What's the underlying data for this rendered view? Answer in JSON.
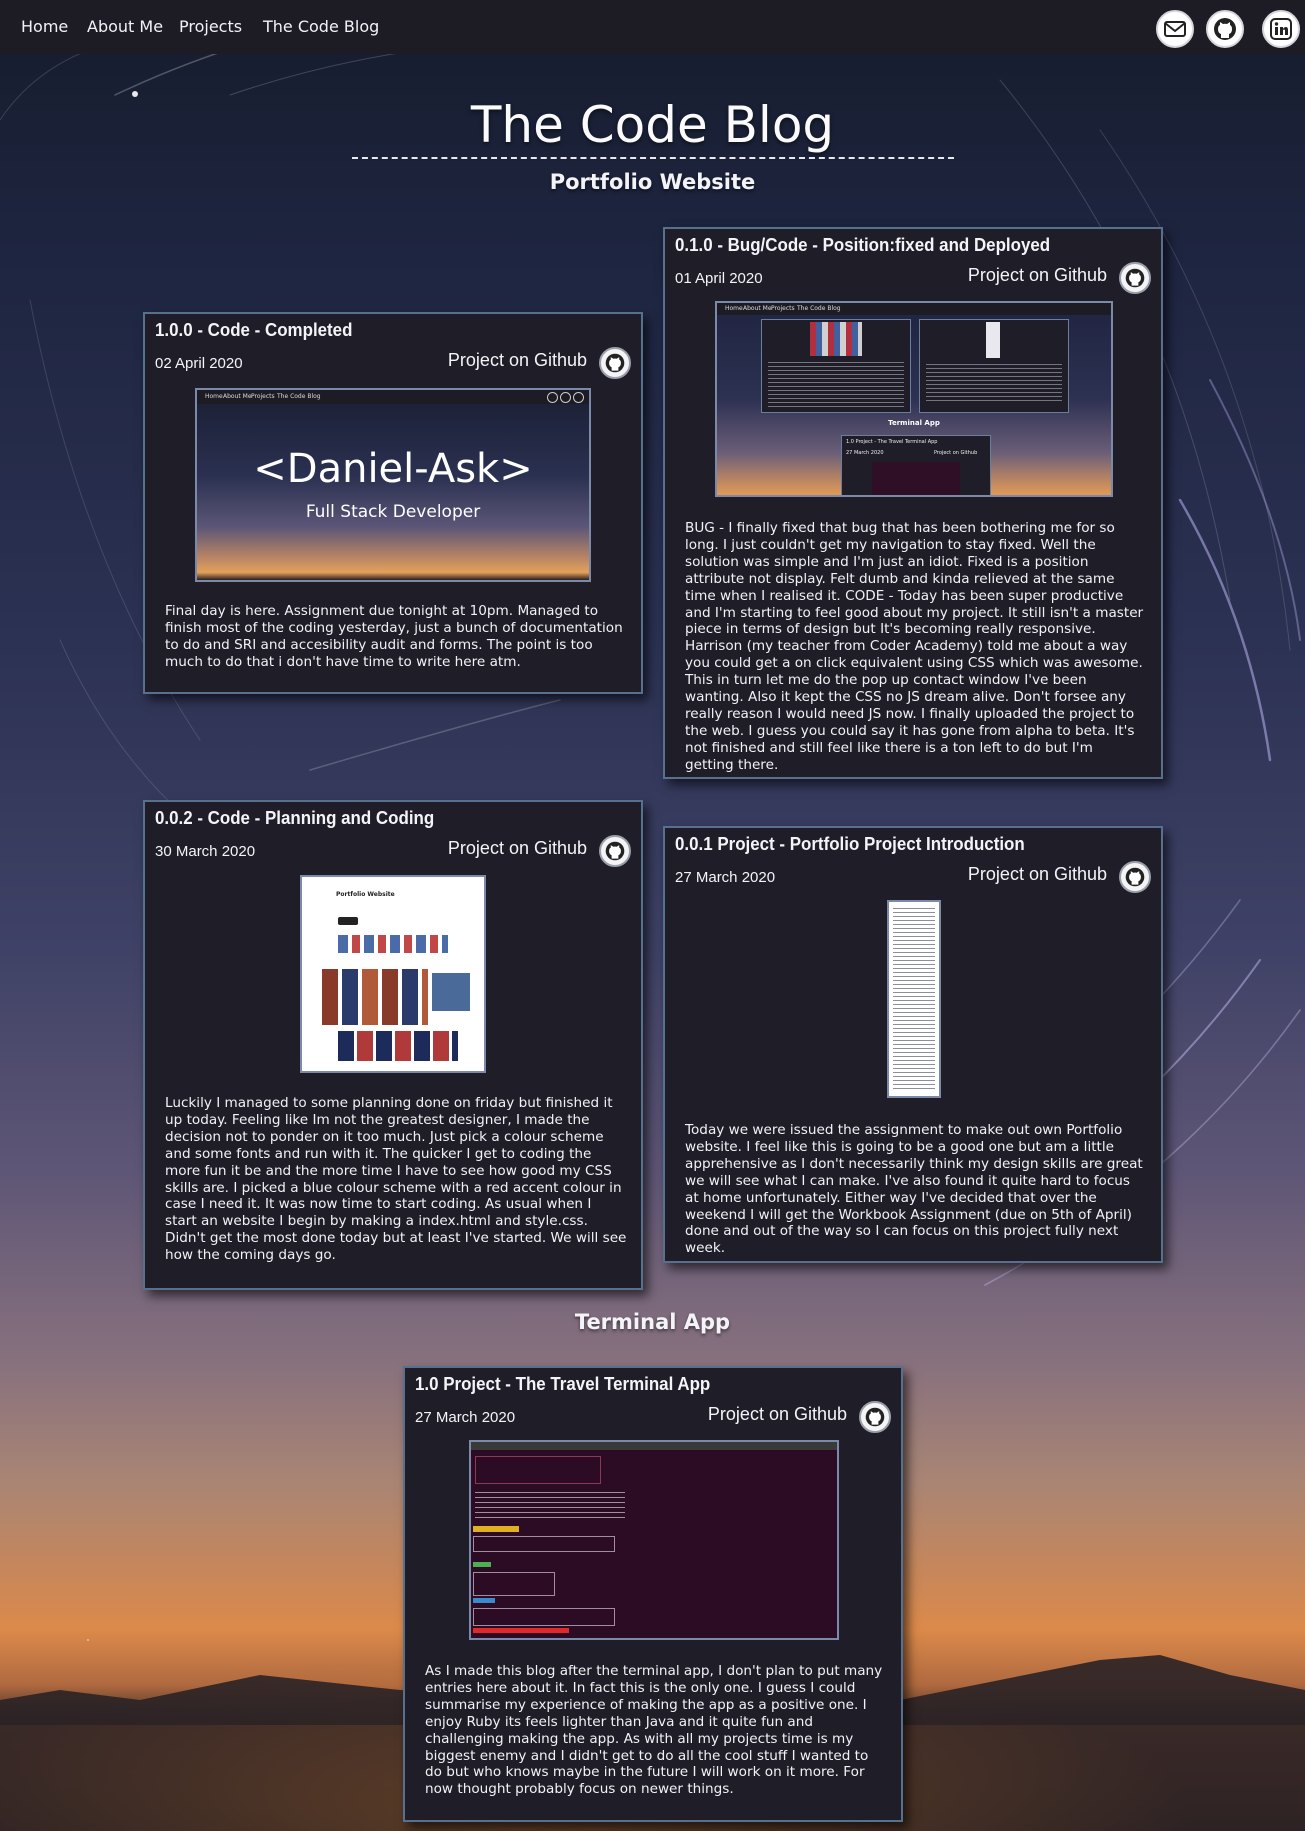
{
  "nav": {
    "links": [
      "Home",
      "About Me",
      "Projects",
      "The Code Blog"
    ],
    "social": [
      "mail-icon",
      "github-icon",
      "linkedin-icon"
    ]
  },
  "page": {
    "title": "The Code Blog",
    "section_portfolio": "Portfolio Website",
    "section_terminal": "Terminal App"
  },
  "posts": [
    {
      "title": "1.0.0 - Code - Completed",
      "date": "02 April 2020",
      "github": "Project on Github",
      "hero_text": "<Daniel-Ask>",
      "hero_sub": "Full Stack Developer",
      "mini_nav": [
        "Home",
        "About Me",
        "Projects",
        "The Code Blog"
      ],
      "body": "Final day is here. Assignment due tonight at 10pm. Managed to finish most of the coding yesterday, just a bunch of documentation to do and SRI and accesibility audit and forms. The point is too much to do that i don't have time to write here atm."
    },
    {
      "title": "0.1.0 - Bug/Code - Position:fixed and Deployed",
      "date": "01 April 2020",
      "github": "Project on Github",
      "mini_nav": [
        "Home",
        "About Me",
        "Projects",
        "The Code Blog"
      ],
      "mini_section": "Terminal App",
      "mini_card_title": "1.0 Project - The Travel Terminal App",
      "mini_card_date": "27 March 2020",
      "mini_card_link": "Project on Github",
      "body": "BUG - I finally fixed that bug that has been bothering me for so long. I just couldn't get my navigation to stay fixed. Well the solution was simple and I'm just an idiot. Fixed is a position attribute not display. Felt dumb and kinda relieved at the same time when I realised it. CODE - Today has been super productive and I'm starting to feel good about my project. It still isn't a master piece in terms of design but It's becoming really responsive. Harrison (my teacher from Coder Academy) told me about a way you could get a on click equivalent using CSS which was awesome. This in turn let me do the pop up contact window I've been wanting. Also it kept the CSS no JS dream alive. Don't forsee any really reason I would need JS now. I finally uploaded the project to the web. I guess you could say it has gone from alpha to beta. It's not finished and still feel like there is a ton left to do but I'm getting there."
    },
    {
      "title": "0.0.2 - Code - Planning and Coding",
      "date": "30 March 2020",
      "github": "Project on Github",
      "mini_title": "Portfolio Website",
      "body": "Luckily I managed to some planning done on friday but finished it up today. Feeling like Im not the greatest designer, I made the decision not to ponder on it too much. Just pick a colour scheme and some fonts and run with it. The quicker I get to coding the more fun it be and the more time I have to see how good my CSS skills are. I picked a blue colour scheme with a red accent colour in case I need it. It was now time to start coding. As usual when I start an website I begin by making a index.html and style.css. Didn't get the most done today but at least I've started. We will see how the coming days go."
    },
    {
      "title": "0.0.1 Project - Portfolio Project Introduction",
      "date": "27 March 2020",
      "github": "Project on Github",
      "body": "Today we were issued the assignment to make out own Portfolio website. I feel like this is going to be a good one but am a little apprehensive as I don't necessarily think my design skills are great we will see what I can make. I've also found it quite hard to focus at home unfortunately. Either way I've decided that over the weekend I will get the Workbook Assignment (due on 5th of April) done and out of the way so I can focus on this project fully next week."
    },
    {
      "title": "1.0 Project - The Travel Terminal App",
      "date": "27 March 2020",
      "github": "Project on Github",
      "body": "As I made this blog after the terminal app, I don't plan to put many entries here about it. In fact this is the only one. I guess I could summarise my experience of making the app as a positive one. I enjoy Ruby its feels lighter than Java and it quite fun and challenging making the app. As with all my projects time is my biggest enemy and I didn't get to do all the cool stuff I wanted to do but who knows maybe in the future I will work on it more. For now thought probably focus on newer things."
    }
  ]
}
